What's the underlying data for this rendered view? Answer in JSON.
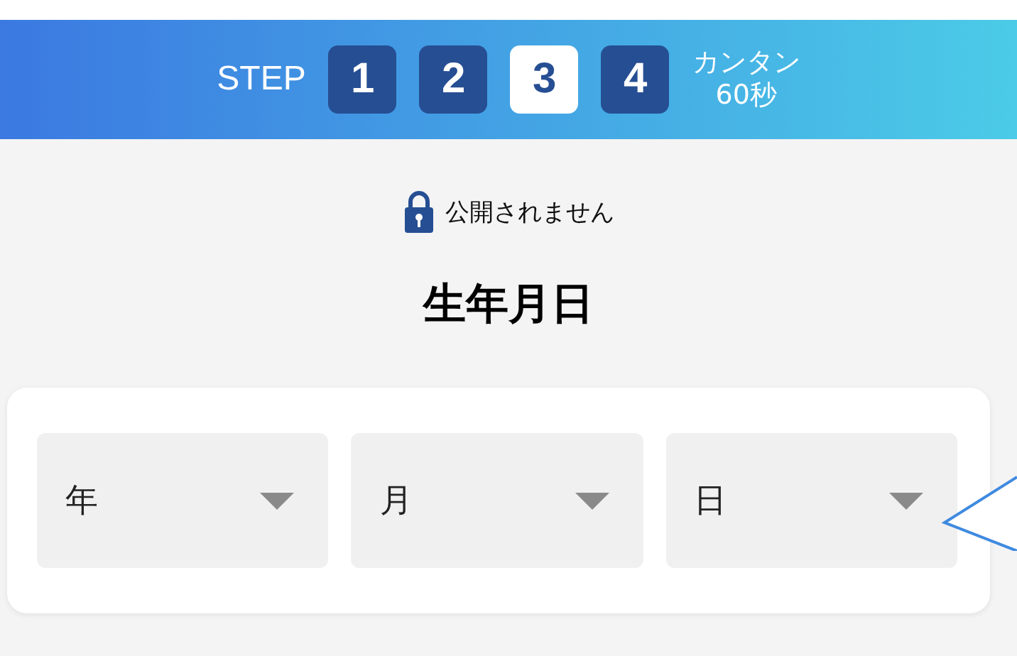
{
  "banner": {
    "label": "STEP",
    "steps": [
      {
        "number": "1",
        "selected": false
      },
      {
        "number": "2",
        "selected": false
      },
      {
        "number": "3",
        "selected": true
      },
      {
        "number": "4",
        "selected": false
      }
    ],
    "note_lines": [
      "カンタン",
      "60秒"
    ]
  },
  "privacy_note": "公開されません",
  "title": "生年月日",
  "selects": [
    {
      "placeholder": "年"
    },
    {
      "placeholder": "月"
    },
    {
      "placeholder": "日"
    }
  ]
}
